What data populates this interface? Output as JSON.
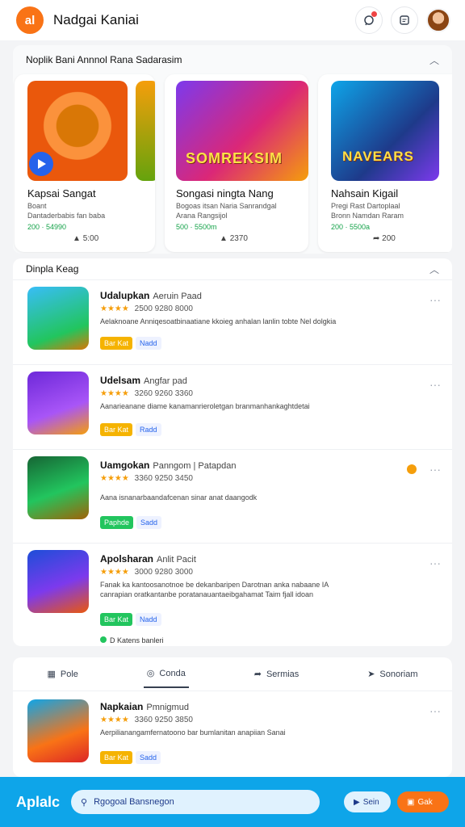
{
  "app": {
    "logo_text": "al",
    "title": "Nadgai Kaniai"
  },
  "header_icons": [
    "notification-icon",
    "message-icon",
    "avatar"
  ],
  "featured": {
    "heading": "Noplik Bani Annnol Rana Sadarasim",
    "cards": [
      {
        "title": "Kapsai Sangat",
        "sub1": "Boant",
        "sub2": "Dantaderbabis fan baba",
        "price": "200 · 54990",
        "count": "5:00"
      },
      {
        "title": "Songasi ningta Nang",
        "sub1": "Bogoas itsan Naria Sanrandgal",
        "sub2": "Arana Rangsijol",
        "price": "500 · 5500m",
        "count": "2370",
        "art_text": "SOMREKSIM"
      },
      {
        "title": "Nahsain Kigail",
        "sub1": "Pregi Rast Dartoplaal",
        "sub2": "Bronn Namdan Raram",
        "price": "200 · 5500a",
        "count": "200",
        "art_text": "NAVEARS"
      }
    ]
  },
  "list": {
    "heading": "Dinpla Keag",
    "items": [
      {
        "title": "Udalupkan",
        "sub": "Aeruin Paad",
        "count": "2500 9280 8000",
        "desc": "Aelaknoane Anniqesoatbinaatiane kkoieg anhalan lanlin tobte Nel dolgkia",
        "tag1": "Bar Kat",
        "tag2": "Nadd"
      },
      {
        "title": "Udelsam",
        "sub": "Angfar pad",
        "count": "3260 9260 3360",
        "desc": "Aanarieanane diame kanamanrieroletgan branmanhankaghtdetai",
        "tag1": "Bar Kat",
        "tag2": "Radd"
      },
      {
        "title": "Uamgokan",
        "sub": "Panngom | Patapdan",
        "count": "3360 9250 3450",
        "desc": "Aana isnanarbaandafcenan sinar anat daangodk",
        "tag1": "Paphde",
        "tag2": "Sadd"
      },
      {
        "title": "Apolsharan",
        "sub": "Anlit Pacit",
        "count": "3000 9280 3000",
        "desc": "Fanak ka kantoosanotnoe be dekanbaripen Darotnan anka nabaane IA",
        "desc2": "canrapian oratkantanbe poratanauantaeibgahamat Taim fjall idoan",
        "tag1": "Bar Kat",
        "tag2": "Nadd",
        "extra": "D Katens banleri"
      }
    ]
  },
  "bottom": {
    "tabs": [
      "Pole",
      "Conda",
      "Sermias",
      "Sonoriam"
    ],
    "item": {
      "title": "Napkaian",
      "sub": "Pmnigmud",
      "count": "3360 9250 3850",
      "desc": "Aerpilianangamfernatoono bar bumlanitan anapiian Sanai",
      "tag1": "Bar Kat",
      "tag2": "Sadd"
    }
  },
  "footer": {
    "brand": "Aplalc",
    "search_placeholder": "Rgogoal Bansnegon",
    "btn_light": "Sein",
    "btn_orange": "Gak"
  },
  "colors": {
    "accent": "#f97316",
    "footer": "#0ea5e9",
    "star": "#f59e0b",
    "price": "#16a34a"
  }
}
